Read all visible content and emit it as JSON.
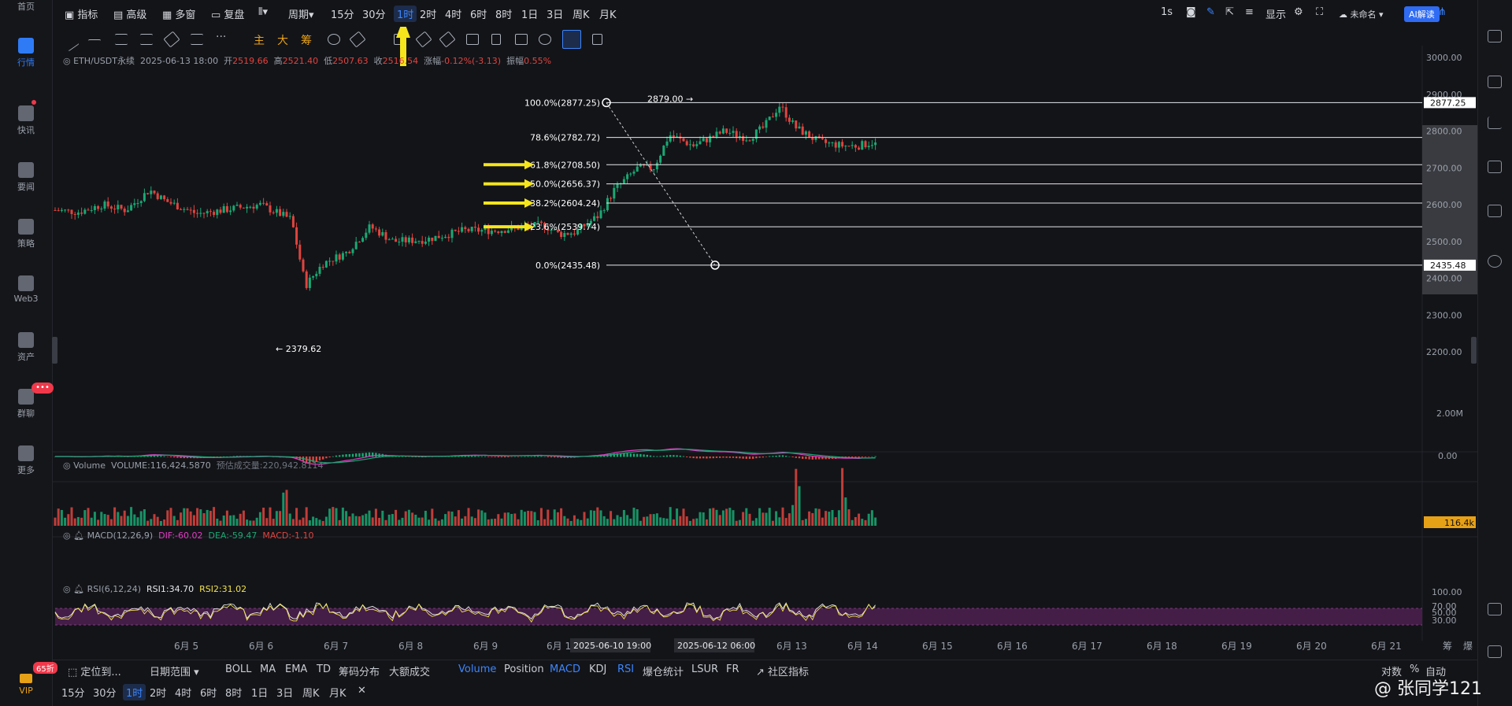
{
  "left_nav": {
    "items": [
      {
        "label": "首页",
        "icon": "home-icon"
      },
      {
        "label": "行情",
        "icon": "market-chart-icon",
        "active": true
      },
      {
        "label": "快讯",
        "icon": "flash-news-icon"
      },
      {
        "label": "要闻",
        "icon": "news-icon"
      },
      {
        "label": "策略",
        "icon": "strategy-icon"
      },
      {
        "label": "Web3",
        "icon": "web3-icon"
      },
      {
        "label": "资产",
        "icon": "wallet-icon"
      },
      {
        "label": "群聊",
        "icon": "chat-icon"
      },
      {
        "label": "更多",
        "icon": "grid-more-icon"
      }
    ],
    "chat_badge": "•••",
    "vip_label": "VIP",
    "vip_sale": "65折"
  },
  "topbar": {
    "indicators": "指标",
    "advanced": "高级",
    "multi_window": "多窗",
    "replay": "复盘",
    "period": "周期",
    "intervals": [
      "15分",
      "30分",
      "1时",
      "2时",
      "4时",
      "6时",
      "8时",
      "1日",
      "3日",
      "周K",
      "月K"
    ],
    "selected_interval": "1时",
    "refresh": "1s",
    "display": "显示",
    "layout_name": "未命名",
    "ai_button": "AI解读"
  },
  "drawing_tools": {
    "main": "主",
    "big": "大",
    "chips": "筹"
  },
  "legend": {
    "symbol": "ETH/USDT永续",
    "datetime": "2025-06-13 18:00",
    "open_label": "开",
    "open": "2519.66",
    "high_label": "高",
    "high": "2521.40",
    "low_label": "低",
    "low": "2507.63",
    "close_label": "收",
    "close": "2516.54",
    "change_label": "涨幅",
    "change": "-0.12%(-3.13)",
    "amp_label": "振幅",
    "amp": "0.55%"
  },
  "volume_legend": {
    "title": "Volume",
    "value": "VOLUME:116,424.5870",
    "forecast": "预估成交量:220,942.8114"
  },
  "macd_legend": {
    "title": "MACD(12,26,9)",
    "dif": "DIF:-60.02",
    "dea": "DEA:-59.47",
    "macd": "MACD:-1.10"
  },
  "rsi_legend": {
    "title": "RSI(6,12,24)",
    "rsi1": "RSI1:34.70",
    "rsi2": "RSI2:31.02"
  },
  "fib_levels": [
    {
      "label": "100.0%(2877.25)",
      "price": 2877.25
    },
    {
      "label": "78.6%(2782.72)",
      "price": 2782.72
    },
    {
      "label": "61.8%(2708.50)",
      "price": 2708.5
    },
    {
      "label": "50.0%(2656.37)",
      "price": 2656.37
    },
    {
      "label": "38.2%(2604.24)",
      "price": 2604.24
    },
    {
      "label": "23.6%(2539.74)",
      "price": 2539.74
    },
    {
      "label": "0.0%(2435.48)",
      "price": 2435.48
    }
  ],
  "fib_tags": [
    "2877.25",
    "2435.48"
  ],
  "annotations": {
    "high": "2879.00 →",
    "low": "← 2379.62"
  },
  "price_axis": [
    "3000.00",
    "2900.00",
    "2800.00",
    "2700.00",
    "2600.00",
    "2500.00",
    "2400.00",
    "2300.00",
    "2200.00"
  ],
  "volume_axis": {
    "max": "2.00M",
    "current": "116.4k"
  },
  "macd_axis": "0.00",
  "rsi_axis": [
    "100.00",
    "70.00",
    "50.00",
    "30.00"
  ],
  "date_axis": [
    "6月 5",
    "6月 6",
    "6月 7",
    "6月 8",
    "6月 9",
    "6月 10",
    "6月 13",
    "6月 14",
    "6月 15",
    "6月 16",
    "6月 17",
    "6月 18",
    "6月 19",
    "6月 20",
    "6月 21"
  ],
  "crosshair_dates": [
    "2025-06-10 19:00",
    "2025-06-12 06:00"
  ],
  "axis_corner": [
    "筹",
    "爆"
  ],
  "bottom_bar": {
    "locate": "定位到...",
    "date_range": "日期范围",
    "overlays": [
      "BOLL",
      "MA",
      "EMA",
      "TD",
      "筹码分布",
      "大额成交"
    ],
    "subcharts": [
      "Volume",
      "Position",
      "MACD",
      "KDJ",
      "RSI",
      "爆仓统计",
      "LSUR",
      "FR"
    ],
    "active_subcharts": [
      "Volume",
      "MACD",
      "RSI"
    ],
    "community": "社区指标",
    "scale_options": [
      "对数",
      "%",
      "自动"
    ],
    "quick_intervals": [
      "15分",
      "30分",
      "1时",
      "2时",
      "4时",
      "6时",
      "8时",
      "1日",
      "3日",
      "周K",
      "月K"
    ],
    "close": "✕"
  },
  "watermark": "@ 张同学121",
  "colors": {
    "up": "#e0443f",
    "down": "#19a974",
    "accent": "#2f7bf6",
    "arrow": "#f5e51c",
    "rsi_band": "#4a1f4d"
  }
}
